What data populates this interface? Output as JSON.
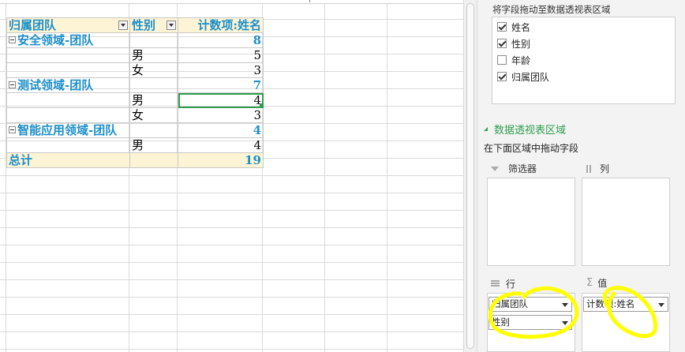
{
  "pivot": {
    "header": {
      "col1": "归属团队",
      "col2": "性别",
      "col3": "计数项:姓名"
    },
    "rows": [
      {
        "type": "group",
        "c1": "安全领域-团队",
        "c2": "",
        "c3": "8"
      },
      {
        "type": "detail",
        "c1": "",
        "c2": "男",
        "c3": "5"
      },
      {
        "type": "detail",
        "c1": "",
        "c2": "女",
        "c3": "3"
      },
      {
        "type": "group",
        "c1": "测试领域-团队",
        "c2": "",
        "c3": "7"
      },
      {
        "type": "detail",
        "c1": "",
        "c2": "男",
        "c3": "4"
      },
      {
        "type": "detail",
        "c1": "",
        "c2": "女",
        "c3": "3"
      },
      {
        "type": "group",
        "c1": "智能应用领域-团队",
        "c2": "",
        "c3": "4"
      },
      {
        "type": "detail",
        "c1": "",
        "c2": "男",
        "c3": "4"
      }
    ],
    "total": {
      "label": "总计",
      "value": "19"
    }
  },
  "pane": {
    "field_header": "将字段拖动至数据透视表区域",
    "fields": [
      {
        "label": "姓名",
        "checked": true
      },
      {
        "label": "性别",
        "checked": true
      },
      {
        "label": "年龄",
        "checked": false
      },
      {
        "label": "归属团队",
        "checked": true
      }
    ],
    "section_title": "数据透视表区域",
    "hint": "在下面区域中拖动字段",
    "zones": {
      "filter_label": "筛选器",
      "columns_label": "列",
      "rows_label": "行",
      "values_label": "值",
      "rows_items": [
        "归属团队",
        "性别"
      ],
      "values_items": [
        "计数项:姓名"
      ]
    }
  },
  "colors": {
    "accent_green": "#2e9e4c",
    "pivot_blue": "#1d8fc8",
    "header_fill": "#fdf3d5",
    "annotation_yellow": "#ffff00"
  }
}
